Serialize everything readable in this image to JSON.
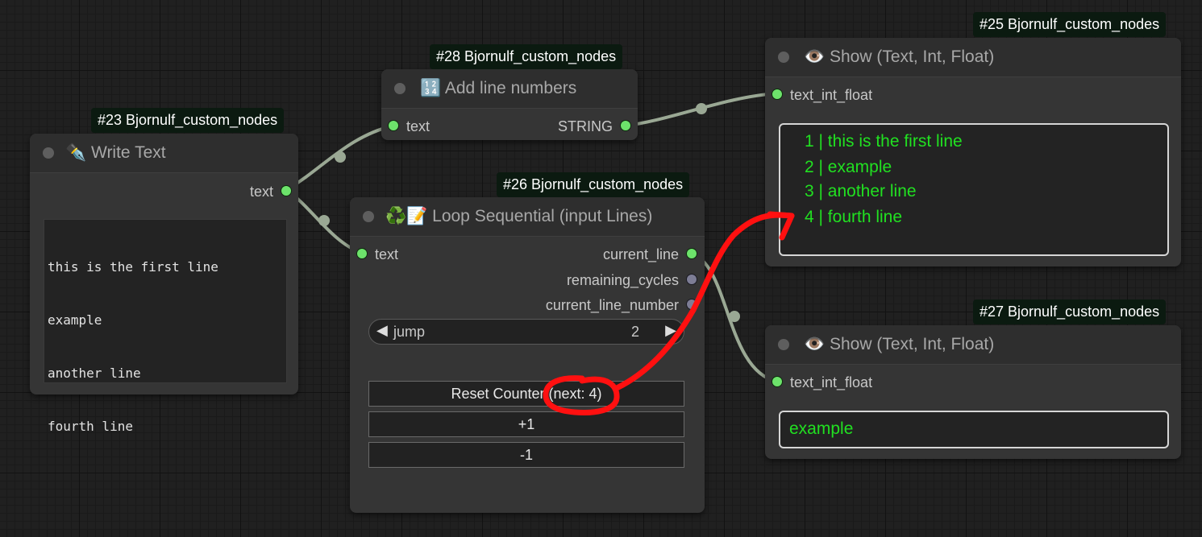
{
  "nodes": {
    "write_text": {
      "badge": "#23 Bjornulf_custom_nodes",
      "icon": "✒️",
      "title": "Write Text",
      "output_label": "text",
      "text_lines": [
        "this is the first line",
        "example",
        "another line",
        "fourth line"
      ]
    },
    "add_line_numbers": {
      "badge": "#28 Bjornulf_custom_nodes",
      "icon": "🔢",
      "title": "Add line numbers",
      "input_label": "text",
      "output_label": "STRING"
    },
    "loop_sequential": {
      "badge": "#26 Bjornulf_custom_nodes",
      "icon": "♻️📝",
      "title": "Loop Sequential (input Lines)",
      "input_label": "text",
      "outputs": [
        "current_line",
        "remaining_cycles",
        "current_line_number"
      ],
      "jump_label": "jump",
      "jump_value": "2",
      "buttons": [
        "Reset Counter (next: 4)",
        "+1",
        "-1"
      ]
    },
    "show_top": {
      "badge": "#25 Bjornulf_custom_nodes",
      "icon": "👁️",
      "title": "Show (Text, Int, Float)",
      "input_label": "text_int_float",
      "lines": [
        "1 | this is the first line",
        "2 | example",
        "3 | another line",
        "4 | fourth line"
      ]
    },
    "show_bottom": {
      "badge": "#27 Bjornulf_custom_nodes",
      "icon": "👁️",
      "title": "Show (Text, Int, Float)",
      "input_label": "text_int_float",
      "lines": [
        "example"
      ]
    }
  },
  "colors": {
    "canvas_bg": "#202020",
    "node_bg": "#353535",
    "wire": "#9aa894",
    "port_connected": "#6de36b",
    "port_idle": "#7d7d95",
    "output_text": "#21e021",
    "annotation": "#ff1010",
    "badge_bg": "#0b1a10"
  }
}
